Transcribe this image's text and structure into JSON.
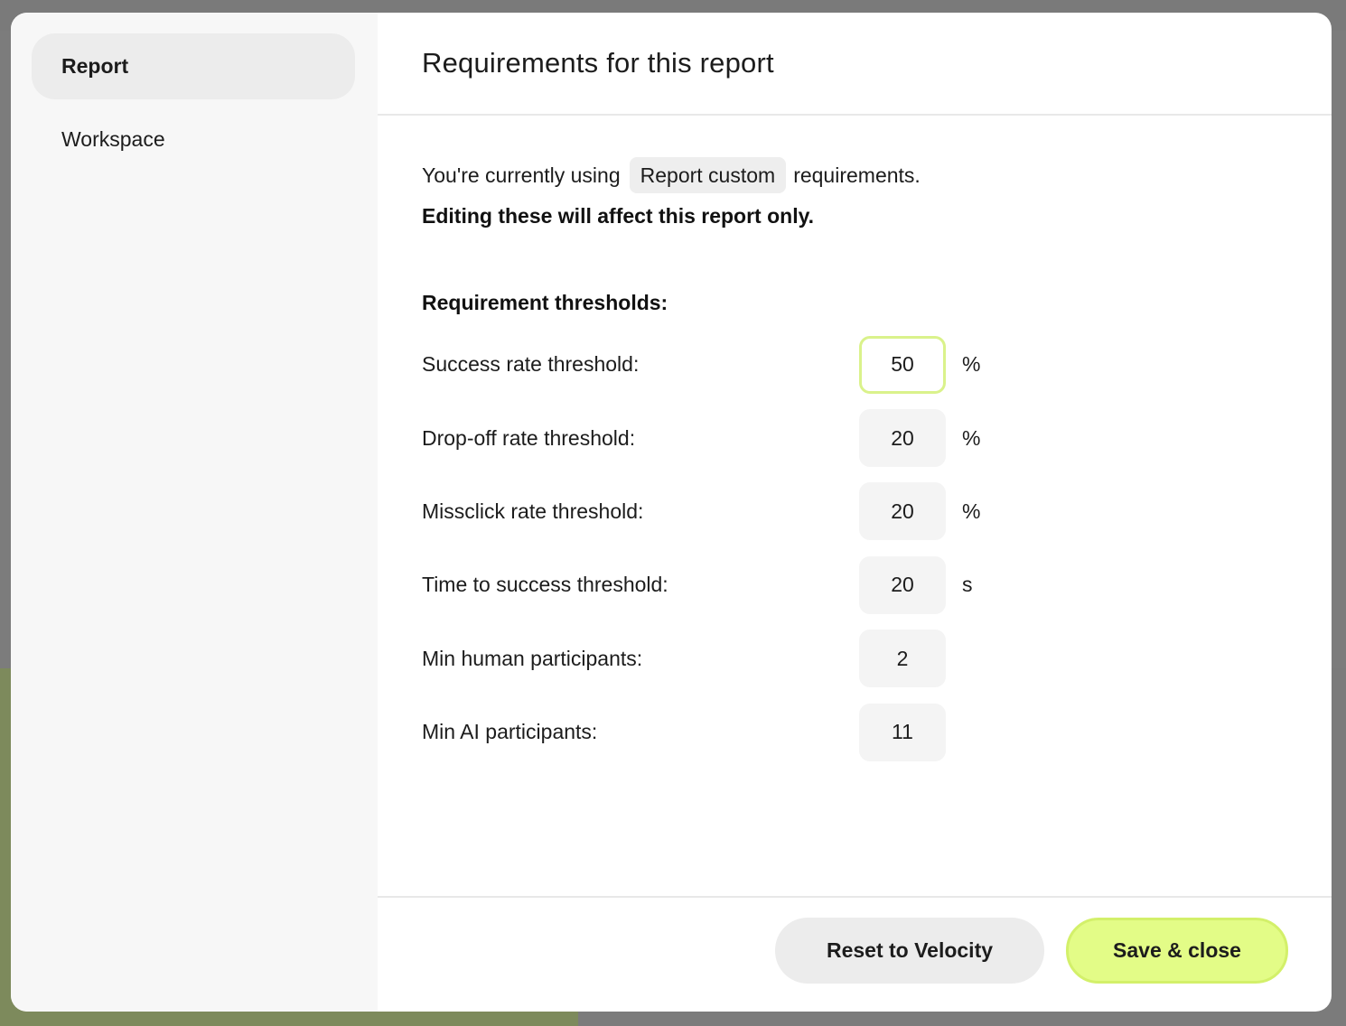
{
  "sidebar": {
    "items": [
      {
        "label": "Report",
        "active": true
      },
      {
        "label": "Workspace",
        "active": false
      }
    ]
  },
  "header": {
    "title": "Requirements for this report"
  },
  "usage": {
    "prefix": "You're currently using",
    "chip": "Report custom",
    "suffix": "requirements."
  },
  "edit_note": "Editing these will affect this report only.",
  "thresholds": {
    "title": "Requirement thresholds:",
    "rows": [
      {
        "label": "Success rate threshold:",
        "value": "50",
        "unit": "%"
      },
      {
        "label": "Drop-off rate threshold:",
        "value": "20",
        "unit": "%"
      },
      {
        "label": "Missclick rate threshold:",
        "value": "20",
        "unit": "%"
      },
      {
        "label": "Time to success threshold:",
        "value": "20",
        "unit": "s"
      },
      {
        "label": "Min human participants:",
        "value": "2",
        "unit": ""
      },
      {
        "label": "Min AI participants:",
        "value": "11",
        "unit": ""
      }
    ]
  },
  "footer": {
    "reset_label": "Reset to Velocity",
    "save_label": "Save & close"
  },
  "colors": {
    "accent": "#e3fc87",
    "accent_border": "#daf28b",
    "sidebar_bg": "#f7f7f7"
  }
}
